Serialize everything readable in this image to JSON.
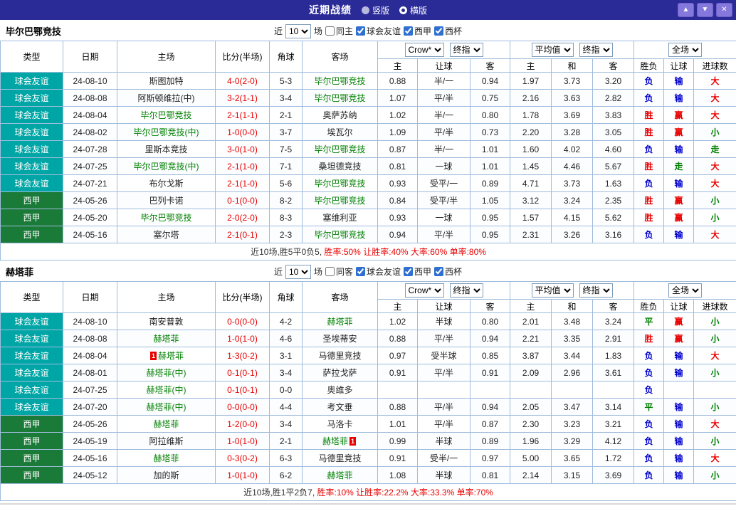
{
  "topbar": {
    "title": "近期战绩",
    "radios": [
      {
        "label": "竖版",
        "selected": false
      },
      {
        "label": "横版",
        "selected": true
      }
    ],
    "buttons": {
      "up": "▲",
      "down": "▼",
      "close": "✕"
    }
  },
  "colors": {
    "topbar_bg": "#2b2b98",
    "button_bg": "#8578dd",
    "table_border": "#9fbcdc",
    "score_red": "#e80000",
    "focus_team_green": "#008000"
  },
  "type_colors": {
    "球会友谊": "#00a6a6",
    "西甲": "#1a7a38"
  },
  "result_colors": {
    "胜": "#e80000",
    "平": "#008000",
    "负": "#0000cc",
    "赢": "#e80000",
    "输": "#0000cc",
    "走": "#008000",
    "大": "#e80000",
    "小": "#008000"
  },
  "sections": [
    {
      "team": "毕尔巴鄂竞技",
      "filters": {
        "near": "近",
        "count": "10",
        "unit": "场",
        "same": {
          "label": "同主",
          "checked": false
        },
        "leagues": [
          {
            "label": "球会友谊",
            "checked": true
          },
          {
            "label": "西甲",
            "checked": true
          },
          {
            "label": "西杯",
            "checked": true
          }
        ]
      },
      "header": {
        "cols": [
          "类型",
          "日期",
          "主场",
          "比分(半场)",
          "角球",
          "客场"
        ],
        "group1": {
          "select1": "Crow*",
          "select2": "终指",
          "subs": [
            "主",
            "让球",
            "客"
          ]
        },
        "group2": {
          "select1": "平均值",
          "select2": "终指",
          "subs": [
            "主",
            "和",
            "客"
          ]
        },
        "group3": {
          "select": "全场",
          "subs": [
            "胜负",
            "让球",
            "进球数"
          ]
        }
      },
      "rows": [
        {
          "type": "球会友谊",
          "date": "24-08-10",
          "home": "斯图加特",
          "score": "4-0(2-0)",
          "corner": "5-3",
          "away": "毕尔巴鄂竞技",
          "away_focus": true,
          "odds": [
            "0.88",
            "半/一",
            "0.94"
          ],
          "avg": [
            "1.97",
            "3.73",
            "3.20"
          ],
          "results": [
            "负",
            "输",
            "大"
          ]
        },
        {
          "type": "球会友谊",
          "date": "24-08-08",
          "home": "阿斯顿维拉(中)",
          "score": "3-2(1-1)",
          "corner": "3-4",
          "away": "毕尔巴鄂竞技",
          "away_focus": true,
          "odds": [
            "1.07",
            "平/半",
            "0.75"
          ],
          "avg": [
            "2.16",
            "3.63",
            "2.82"
          ],
          "results": [
            "负",
            "输",
            "大"
          ]
        },
        {
          "type": "球会友谊",
          "date": "24-08-04",
          "home": "毕尔巴鄂竞技",
          "home_focus": true,
          "score": "2-1(1-1)",
          "corner": "2-1",
          "away": "奥萨苏纳",
          "odds": [
            "1.02",
            "半/一",
            "0.80"
          ],
          "avg": [
            "1.78",
            "3.69",
            "3.83"
          ],
          "results": [
            "胜",
            "赢",
            "大"
          ]
        },
        {
          "type": "球会友谊",
          "date": "24-08-02",
          "home": "毕尔巴鄂竞技(中)",
          "home_focus": true,
          "score": "1-0(0-0)",
          "corner": "3-7",
          "away": "埃瓦尔",
          "odds": [
            "1.09",
            "平/半",
            "0.73"
          ],
          "avg": [
            "2.20",
            "3.28",
            "3.05"
          ],
          "results": [
            "胜",
            "赢",
            "小"
          ]
        },
        {
          "type": "球会友谊",
          "date": "24-07-28",
          "home": "里斯本竞技",
          "score": "3-0(1-0)",
          "corner": "7-5",
          "away": "毕尔巴鄂竞技",
          "away_focus": true,
          "odds": [
            "0.87",
            "半/一",
            "1.01"
          ],
          "avg": [
            "1.60",
            "4.02",
            "4.60"
          ],
          "results": [
            "负",
            "输",
            "走"
          ]
        },
        {
          "type": "球会友谊",
          "date": "24-07-25",
          "home": "毕尔巴鄂竞技(中)",
          "home_focus": true,
          "score": "2-1(1-0)",
          "corner": "7-1",
          "away": "桑坦德竞技",
          "odds": [
            "0.81",
            "一球",
            "1.01"
          ],
          "avg": [
            "1.45",
            "4.46",
            "5.67"
          ],
          "results": [
            "胜",
            "走",
            "大"
          ]
        },
        {
          "type": "球会友谊",
          "date": "24-07-21",
          "home": "布尔戈斯",
          "score": "2-1(1-0)",
          "corner": "5-6",
          "away": "毕尔巴鄂竞技",
          "away_focus": true,
          "odds": [
            "0.93",
            "受平/一",
            "0.89"
          ],
          "avg": [
            "4.71",
            "3.73",
            "1.63"
          ],
          "results": [
            "负",
            "输",
            "大"
          ]
        },
        {
          "type": "西甲",
          "date": "24-05-26",
          "home": "巴列卡诺",
          "score": "0-1(0-0)",
          "corner": "8-2",
          "away": "毕尔巴鄂竞技",
          "away_focus": true,
          "odds": [
            "0.84",
            "受平/半",
            "1.05"
          ],
          "avg": [
            "3.12",
            "3.24",
            "2.35"
          ],
          "results": [
            "胜",
            "赢",
            "小"
          ]
        },
        {
          "type": "西甲",
          "date": "24-05-20",
          "home": "毕尔巴鄂竞技",
          "home_focus": true,
          "score": "2-0(2-0)",
          "corner": "8-3",
          "away": "塞维利亚",
          "odds": [
            "0.93",
            "一球",
            "0.95"
          ],
          "avg": [
            "1.57",
            "4.15",
            "5.62"
          ],
          "results": [
            "胜",
            "赢",
            "小"
          ]
        },
        {
          "type": "西甲",
          "date": "24-05-16",
          "home": "塞尔塔",
          "score": "2-1(0-1)",
          "corner": "2-3",
          "away": "毕尔巴鄂竞技",
          "away_focus": true,
          "odds": [
            "0.94",
            "平/半",
            "0.95"
          ],
          "avg": [
            "2.31",
            "3.26",
            "3.16"
          ],
          "results": [
            "负",
            "输",
            "大"
          ]
        }
      ],
      "summary": [
        {
          "text": "近10场,胜5平0负5, ",
          "color": "#333333"
        },
        {
          "text": "胜率:50%",
          "color": "#e80000"
        },
        {
          "text": " 让胜率:40%",
          "color": "#e80000"
        },
        {
          "text": " 大率:60%",
          "color": "#e80000"
        },
        {
          "text": " 单率:80%",
          "color": "#e80000"
        }
      ]
    },
    {
      "team": "赫塔菲",
      "filters": {
        "near": "近",
        "count": "10",
        "unit": "场",
        "same": {
          "label": "同客",
          "checked": false
        },
        "leagues": [
          {
            "label": "球会友谊",
            "checked": true
          },
          {
            "label": "西甲",
            "checked": true
          },
          {
            "label": "西杯",
            "checked": true
          }
        ]
      },
      "header": {
        "cols": [
          "类型",
          "日期",
          "主场",
          "比分(半场)",
          "角球",
          "客场"
        ],
        "group1": {
          "select1": "Crow*",
          "select2": "终指",
          "subs": [
            "主",
            "让球",
            "客"
          ]
        },
        "group2": {
          "select1": "平均值",
          "select2": "终指",
          "subs": [
            "主",
            "和",
            "客"
          ]
        },
        "group3": {
          "select": "全场",
          "subs": [
            "胜负",
            "让球",
            "进球数"
          ]
        }
      },
      "rows": [
        {
          "type": "球会友谊",
          "date": "24-08-10",
          "home": "南安普敦",
          "score": "0-0(0-0)",
          "corner": "4-2",
          "away": "赫塔菲",
          "away_focus": true,
          "odds": [
            "1.02",
            "半球",
            "0.80"
          ],
          "avg": [
            "2.01",
            "3.48",
            "3.24"
          ],
          "results": [
            "平",
            "赢",
            "小"
          ]
        },
        {
          "type": "球会友谊",
          "date": "24-08-08",
          "home": "赫塔菲",
          "home_focus": true,
          "score": "1-0(1-0)",
          "corner": "4-6",
          "away": "圣埃蒂安",
          "odds": [
            "0.88",
            "平/半",
            "0.94"
          ],
          "avg": [
            "2.21",
            "3.35",
            "2.91"
          ],
          "results": [
            "胜",
            "赢",
            "小"
          ]
        },
        {
          "type": "球会友谊",
          "date": "24-08-04",
          "home": "赫塔菲",
          "home_focus": true,
          "home_card": 1,
          "score": "1-3(0-2)",
          "corner": "3-1",
          "away": "马德里竞技",
          "odds": [
            "0.97",
            "受半球",
            "0.85"
          ],
          "avg": [
            "3.87",
            "3.44",
            "1.83"
          ],
          "results": [
            "负",
            "输",
            "大"
          ]
        },
        {
          "type": "球会友谊",
          "date": "24-08-01",
          "home": "赫塔菲(中)",
          "home_focus": true,
          "score": "0-1(0-1)",
          "corner": "3-4",
          "away": "萨拉戈萨",
          "odds": [
            "0.91",
            "平/半",
            "0.91"
          ],
          "avg": [
            "2.09",
            "2.96",
            "3.61"
          ],
          "results": [
            "负",
            "输",
            "小"
          ]
        },
        {
          "type": "球会友谊",
          "date": "24-07-25",
          "home": "赫塔菲(中)",
          "home_focus": true,
          "score": "0-1(0-1)",
          "corner": "0-0",
          "away": "奥维多",
          "odds": [
            "",
            "",
            ""
          ],
          "avg": [
            "",
            "",
            ""
          ],
          "results": [
            "负",
            "",
            ""
          ]
        },
        {
          "type": "球会友谊",
          "date": "24-07-20",
          "home": "赫塔菲(中)",
          "home_focus": true,
          "score": "0-0(0-0)",
          "corner": "4-4",
          "away": "考文垂",
          "odds": [
            "0.88",
            "平/半",
            "0.94"
          ],
          "avg": [
            "2.05",
            "3.47",
            "3.14"
          ],
          "results": [
            "平",
            "输",
            "小"
          ]
        },
        {
          "type": "西甲",
          "date": "24-05-26",
          "home": "赫塔菲",
          "home_focus": true,
          "score": "1-2(0-0)",
          "corner": "3-4",
          "away": "马洛卡",
          "odds": [
            "1.01",
            "平/半",
            "0.87"
          ],
          "avg": [
            "2.30",
            "3.23",
            "3.21"
          ],
          "results": [
            "负",
            "输",
            "大"
          ]
        },
        {
          "type": "西甲",
          "date": "24-05-19",
          "home": "阿拉维斯",
          "score": "1-0(1-0)",
          "corner": "2-1",
          "away": "赫塔菲",
          "away_focus": true,
          "away_card": 1,
          "odds": [
            "0.99",
            "半球",
            "0.89"
          ],
          "avg": [
            "1.96",
            "3.29",
            "4.12"
          ],
          "results": [
            "负",
            "输",
            "小"
          ]
        },
        {
          "type": "西甲",
          "date": "24-05-16",
          "home": "赫塔菲",
          "home_focus": true,
          "score": "0-3(0-2)",
          "corner": "6-3",
          "away": "马德里竞技",
          "odds": [
            "0.91",
            "受半/一",
            "0.97"
          ],
          "avg": [
            "5.00",
            "3.65",
            "1.72"
          ],
          "results": [
            "负",
            "输",
            "大"
          ]
        },
        {
          "type": "西甲",
          "date": "24-05-12",
          "home": "加的斯",
          "score": "1-0(1-0)",
          "corner": "6-2",
          "away": "赫塔菲",
          "away_focus": true,
          "odds": [
            "1.08",
            "半球",
            "0.81"
          ],
          "avg": [
            "2.14",
            "3.15",
            "3.69"
          ],
          "results": [
            "负",
            "输",
            "小"
          ]
        }
      ],
      "summary": [
        {
          "text": "近10场,胜1平2负7, ",
          "color": "#333333"
        },
        {
          "text": "胜率:10%",
          "color": "#e80000"
        },
        {
          "text": " 让胜率:22.2%",
          "color": "#e80000"
        },
        {
          "text": " 大率:33.3%",
          "color": "#e80000"
        },
        {
          "text": " 单率:70%",
          "color": "#e80000"
        }
      ]
    }
  ]
}
